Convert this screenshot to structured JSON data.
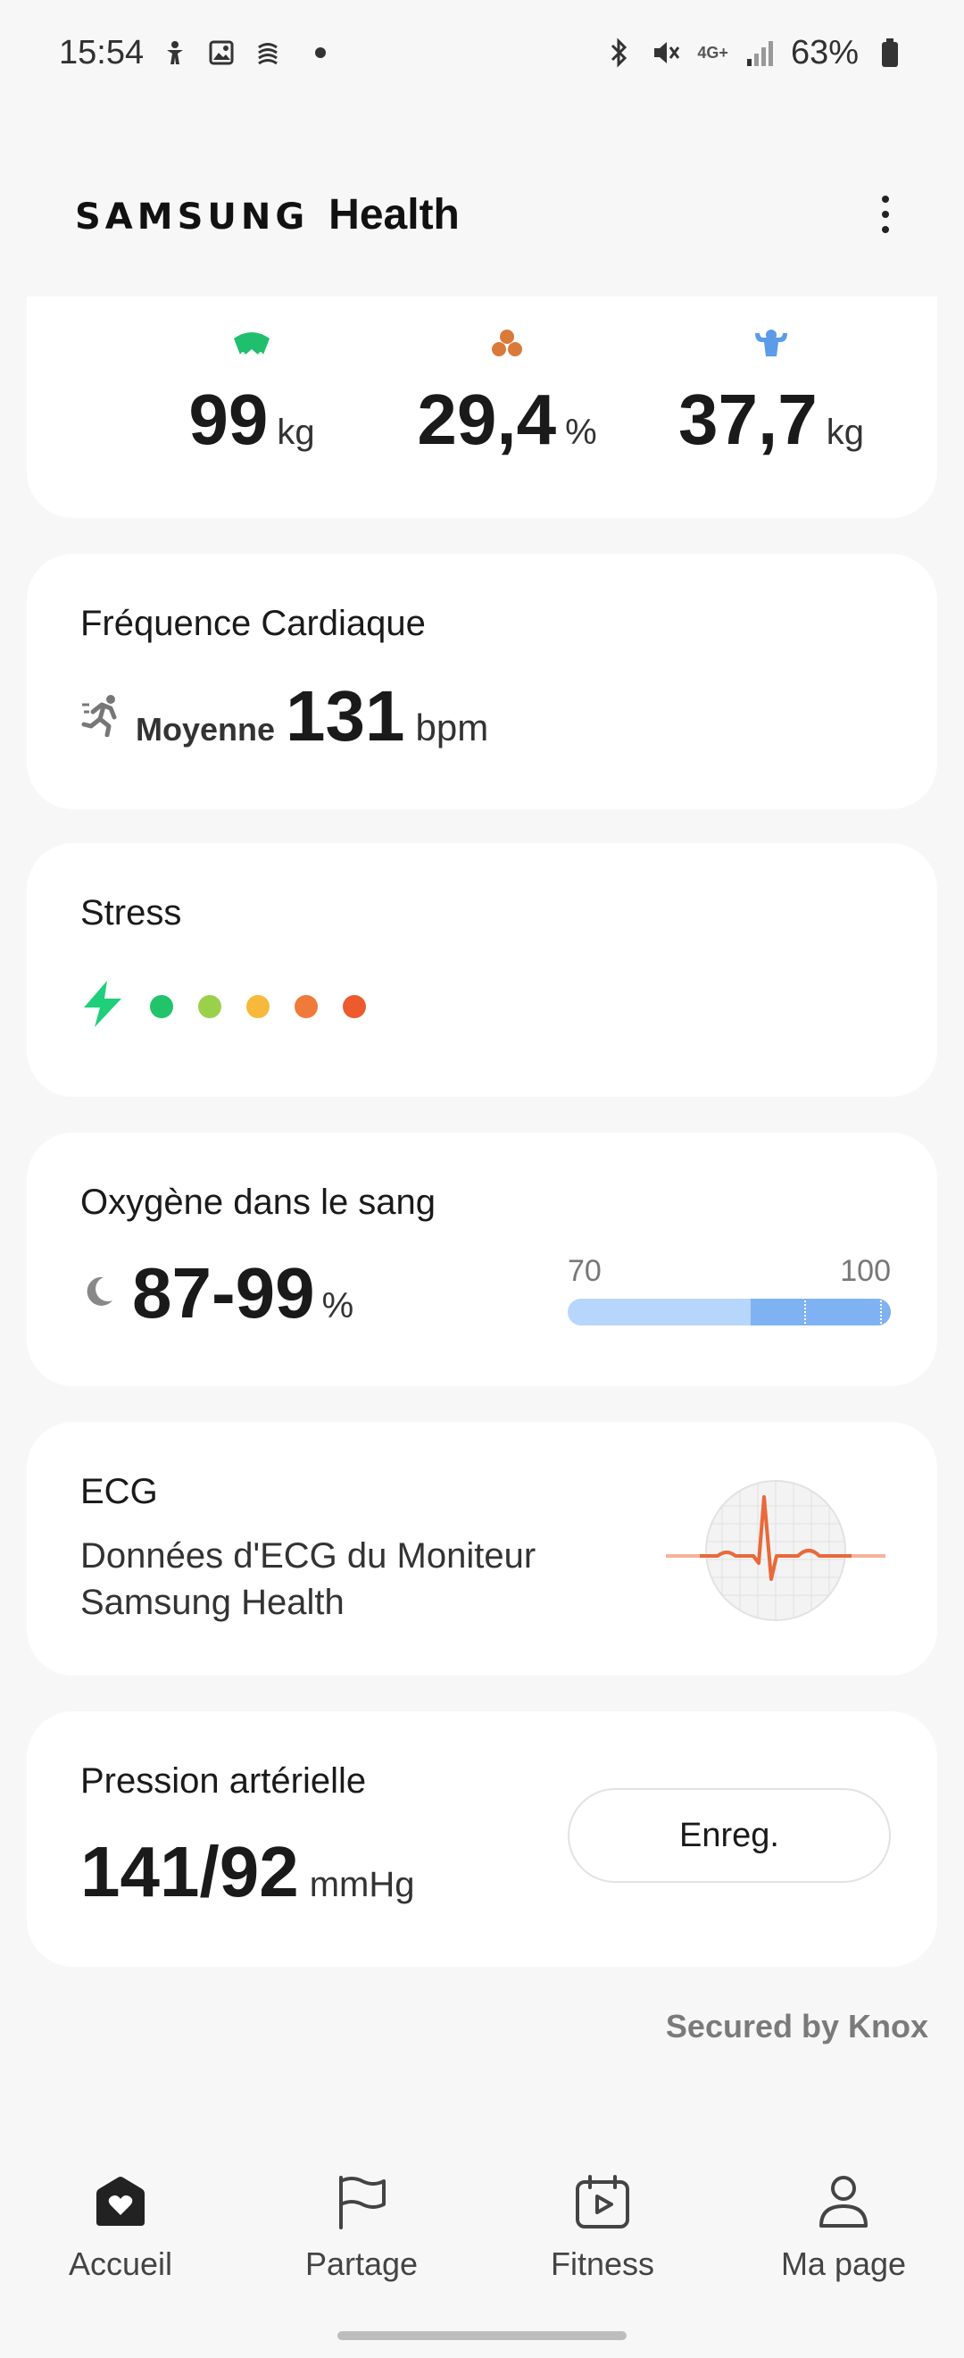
{
  "status_bar": {
    "time": "15:54",
    "network": "4G+",
    "battery": "63%",
    "left_icons": [
      "accessibility-icon",
      "gallery-icon",
      "sync-icon"
    ],
    "right_icons": [
      "bluetooth-icon",
      "mute-icon",
      "signal-icon",
      "battery-icon"
    ]
  },
  "header": {
    "brand": "SAMSUNG",
    "app": "Health",
    "menu_icon": "more-vertical-icon"
  },
  "body_composition": {
    "items": [
      {
        "value": "99",
        "unit": "kg",
        "icon": "weight-icon",
        "color": "#1fbf6e"
      },
      {
        "value": "29,4",
        "unit": "%",
        "icon": "body-fat-icon",
        "color": "#d97a3a"
      },
      {
        "value": "37,7",
        "unit": "kg",
        "icon": "muscle-icon",
        "color": "#5b9be8"
      }
    ]
  },
  "heart_rate": {
    "title": "Fréquence Cardiaque",
    "label": "Moyenne",
    "value": "131",
    "unit": "bpm",
    "icon": "running-icon"
  },
  "stress": {
    "title": "Stress",
    "icon": "lightning-icon",
    "icon_color": "#1fcf7a",
    "dots": [
      "#22c46a",
      "#9ad14b",
      "#f6b93b",
      "#f07a3a",
      "#ec5a2e"
    ]
  },
  "oxygen": {
    "title": "Oxygène dans le sang",
    "value": "87-99",
    "unit": "%",
    "icon": "moon-icon",
    "scale_min": "70",
    "scale_max": "100",
    "range_low": 87,
    "range_high": 99,
    "colors": {
      "track": "#b7d6fb",
      "fill": "#7fb2f2"
    }
  },
  "ecg": {
    "title": "ECG",
    "subtitle": "Données d'ECG du Moniteur Samsung Health",
    "icon": "ecg-waveform-icon",
    "wave_color": "#e8693a"
  },
  "blood_pressure": {
    "title": "Pression artérielle",
    "value": "141/92",
    "unit": "mmHg",
    "button_label": "Enreg."
  },
  "footer": {
    "knox": "Secured by Knox"
  },
  "bottom_nav": [
    {
      "label": "Accueil",
      "icon": "home-heart-icon",
      "active": true
    },
    {
      "label": "Partage",
      "icon": "flag-icon",
      "active": false
    },
    {
      "label": "Fitness",
      "icon": "calendar-play-icon",
      "active": false
    },
    {
      "label": "Ma page",
      "icon": "person-icon",
      "active": false
    }
  ]
}
